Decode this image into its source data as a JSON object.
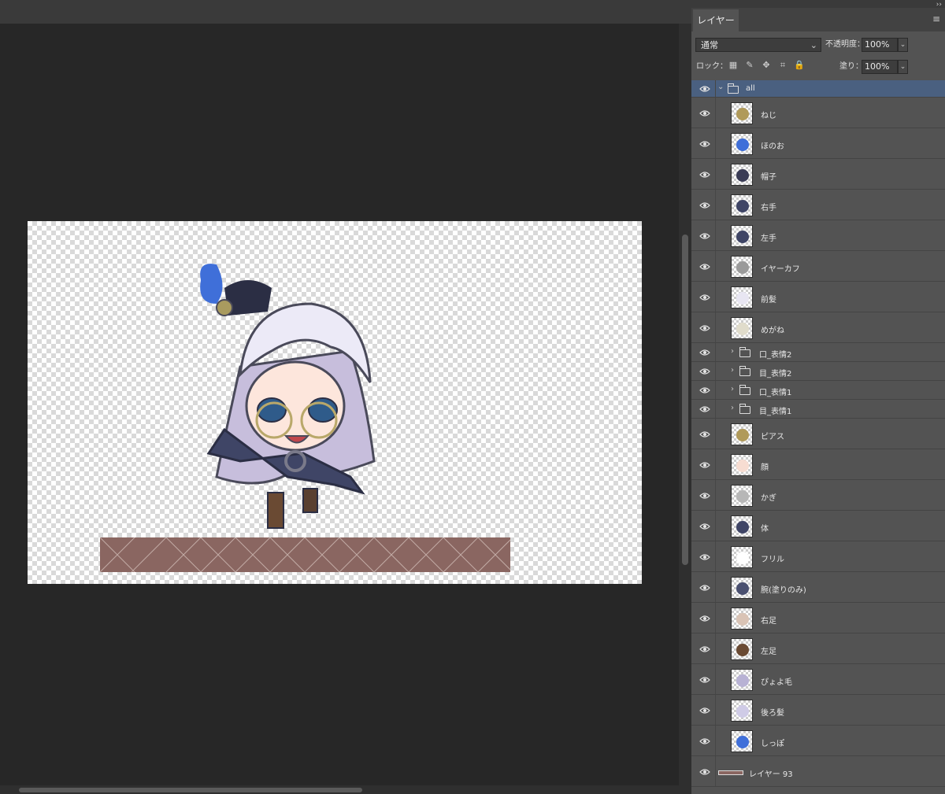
{
  "panel": {
    "tab_label": "レイヤー",
    "blend_mode": "通常",
    "opacity_label": "不透明度：",
    "opacity_value": "100%",
    "lock_label": "ロック：",
    "fill_label": "塗り：",
    "fill_value": "100%"
  },
  "layers": [
    {
      "name": "all"
    },
    {
      "name": "ねじ"
    },
    {
      "name": "ほのお"
    },
    {
      "name": "帽子"
    },
    {
      "name": "右手"
    },
    {
      "name": "左手"
    },
    {
      "name": "イヤーカフ"
    },
    {
      "name": "前髪"
    },
    {
      "name": "めがね"
    },
    {
      "name": "口_表情2"
    },
    {
      "name": "目_表情2"
    },
    {
      "name": "口_表情1"
    },
    {
      "name": "目_表情1"
    },
    {
      "name": "ピアス"
    },
    {
      "name": "顔"
    },
    {
      "name": "かぎ"
    },
    {
      "name": "体"
    },
    {
      "name": "フリル"
    },
    {
      "name": "腕(塗りのみ)"
    },
    {
      "name": "右足"
    },
    {
      "name": "左足"
    },
    {
      "name": "ぴょよ毛"
    },
    {
      "name": "後ろ髪"
    },
    {
      "name": "しっぽ"
    },
    {
      "name": "レイヤー 93"
    }
  ],
  "colors": {
    "panel_bg": "#535353",
    "selected_row": "#4a6080",
    "ground": "#8a6661",
    "workspace": "#272727"
  }
}
